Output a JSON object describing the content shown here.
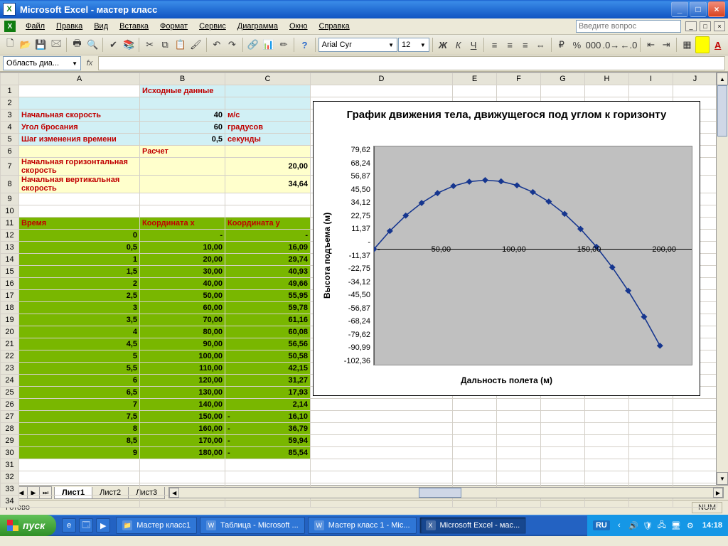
{
  "title": "Microsoft Excel - мастер класс",
  "menu": [
    "Файл",
    "Правка",
    "Вид",
    "Вставка",
    "Формат",
    "Сервис",
    "Диаграмма",
    "Окно",
    "Справка"
  ],
  "ask_placeholder": "Введите вопрос",
  "font": {
    "name": "Arial Cyr",
    "size": "12"
  },
  "namebox": "Область диа...",
  "columns": [
    "A",
    "B",
    "C",
    "D",
    "E",
    "F",
    "G",
    "H",
    "I",
    "J"
  ],
  "cells": {
    "header1": "Исходные данные",
    "r3a": "Начальная скорость",
    "r3b": "40",
    "r3c": "м/с",
    "r4a": "Угол бросания",
    "r4b": "60",
    "r4c": "градусов",
    "r5a": "Шаг изменения времени",
    "r5b": "0,5",
    "r5c": "секунды",
    "r6": "Расчет",
    "r7a": "Начальная горизонтальная скорость",
    "r7c": "20,00",
    "r8a": "Начальная вертикальная скорость",
    "r8c": "34,64",
    "r11a": "Время",
    "r11b": "Координата x",
    "r11c": "Координата y"
  },
  "table": [
    {
      "t": "0",
      "x": "-",
      "y": "-",
      "yneg": false
    },
    {
      "t": "0,5",
      "x": "10,00",
      "y": "16,09",
      "yneg": false
    },
    {
      "t": "1",
      "x": "20,00",
      "y": "29,74",
      "yneg": false
    },
    {
      "t": "1,5",
      "x": "30,00",
      "y": "40,93",
      "yneg": false
    },
    {
      "t": "2",
      "x": "40,00",
      "y": "49,66",
      "yneg": false
    },
    {
      "t": "2,5",
      "x": "50,00",
      "y": "55,95",
      "yneg": false
    },
    {
      "t": "3",
      "x": "60,00",
      "y": "59,78",
      "yneg": false
    },
    {
      "t": "3,5",
      "x": "70,00",
      "y": "61,16",
      "yneg": false
    },
    {
      "t": "4",
      "x": "80,00",
      "y": "60,08",
      "yneg": false
    },
    {
      "t": "4,5",
      "x": "90,00",
      "y": "56,56",
      "yneg": false
    },
    {
      "t": "5",
      "x": "100,00",
      "y": "50,58",
      "yneg": false
    },
    {
      "t": "5,5",
      "x": "110,00",
      "y": "42,15",
      "yneg": false
    },
    {
      "t": "6",
      "x": "120,00",
      "y": "31,27",
      "yneg": false
    },
    {
      "t": "6,5",
      "x": "130,00",
      "y": "17,93",
      "yneg": false
    },
    {
      "t": "7",
      "x": "140,00",
      "y": "2,14",
      "yneg": false
    },
    {
      "t": "7,5",
      "x": "150,00",
      "y": "16,10",
      "yneg": true
    },
    {
      "t": "8",
      "x": "160,00",
      "y": "36,79",
      "yneg": true
    },
    {
      "t": "8,5",
      "x": "170,00",
      "y": "59,94",
      "yneg": true
    },
    {
      "t": "9",
      "x": "180,00",
      "y": "85,54",
      "yneg": true
    }
  ],
  "chart_data": {
    "type": "line",
    "title": "График движения тела, движущегося под углом к горизонту",
    "xlabel": "Дальность полета (м)",
    "ylabel": "Высота подъема (м)",
    "yticks": [
      "79,62",
      "68,24",
      "56,87",
      "45,50",
      "34,12",
      "22,75",
      "11,37",
      "-",
      "-11,37",
      "-22,75",
      "-34,12",
      "-45,50",
      "-56,87",
      "-68,24",
      "-79,62",
      "-90,99",
      "-102,36"
    ],
    "xticks": [
      "-",
      "50,00",
      "100,00",
      "150,00",
      "200,00"
    ],
    "xlim": [
      0,
      200
    ],
    "ylim": [
      -102.36,
      91
    ],
    "x": [
      0,
      10,
      20,
      30,
      40,
      50,
      60,
      70,
      80,
      90,
      100,
      110,
      120,
      130,
      140,
      150,
      160,
      170,
      180
    ],
    "y": [
      0,
      16.09,
      29.74,
      40.93,
      49.66,
      55.95,
      59.78,
      61.16,
      60.08,
      56.56,
      50.58,
      42.15,
      31.27,
      17.93,
      2.14,
      -16.1,
      -36.79,
      -59.94,
      -85.54
    ]
  },
  "tabs": [
    "Лист1",
    "Лист2",
    "Лист3"
  ],
  "status": {
    "ready": "Готово",
    "num": "NUM"
  },
  "taskbar": {
    "start": "пуск",
    "tasks": [
      {
        "label": "Мастер класс1",
        "icon": "📁",
        "active": false
      },
      {
        "label": "Таблица - Microsoft ...",
        "icon": "W",
        "active": false
      },
      {
        "label": "Мастер класс 1 - Mic...",
        "icon": "W",
        "active": false
      },
      {
        "label": "Microsoft Excel - мас...",
        "icon": "X",
        "active": true
      }
    ],
    "lang": "RU",
    "clock": "14:18"
  }
}
